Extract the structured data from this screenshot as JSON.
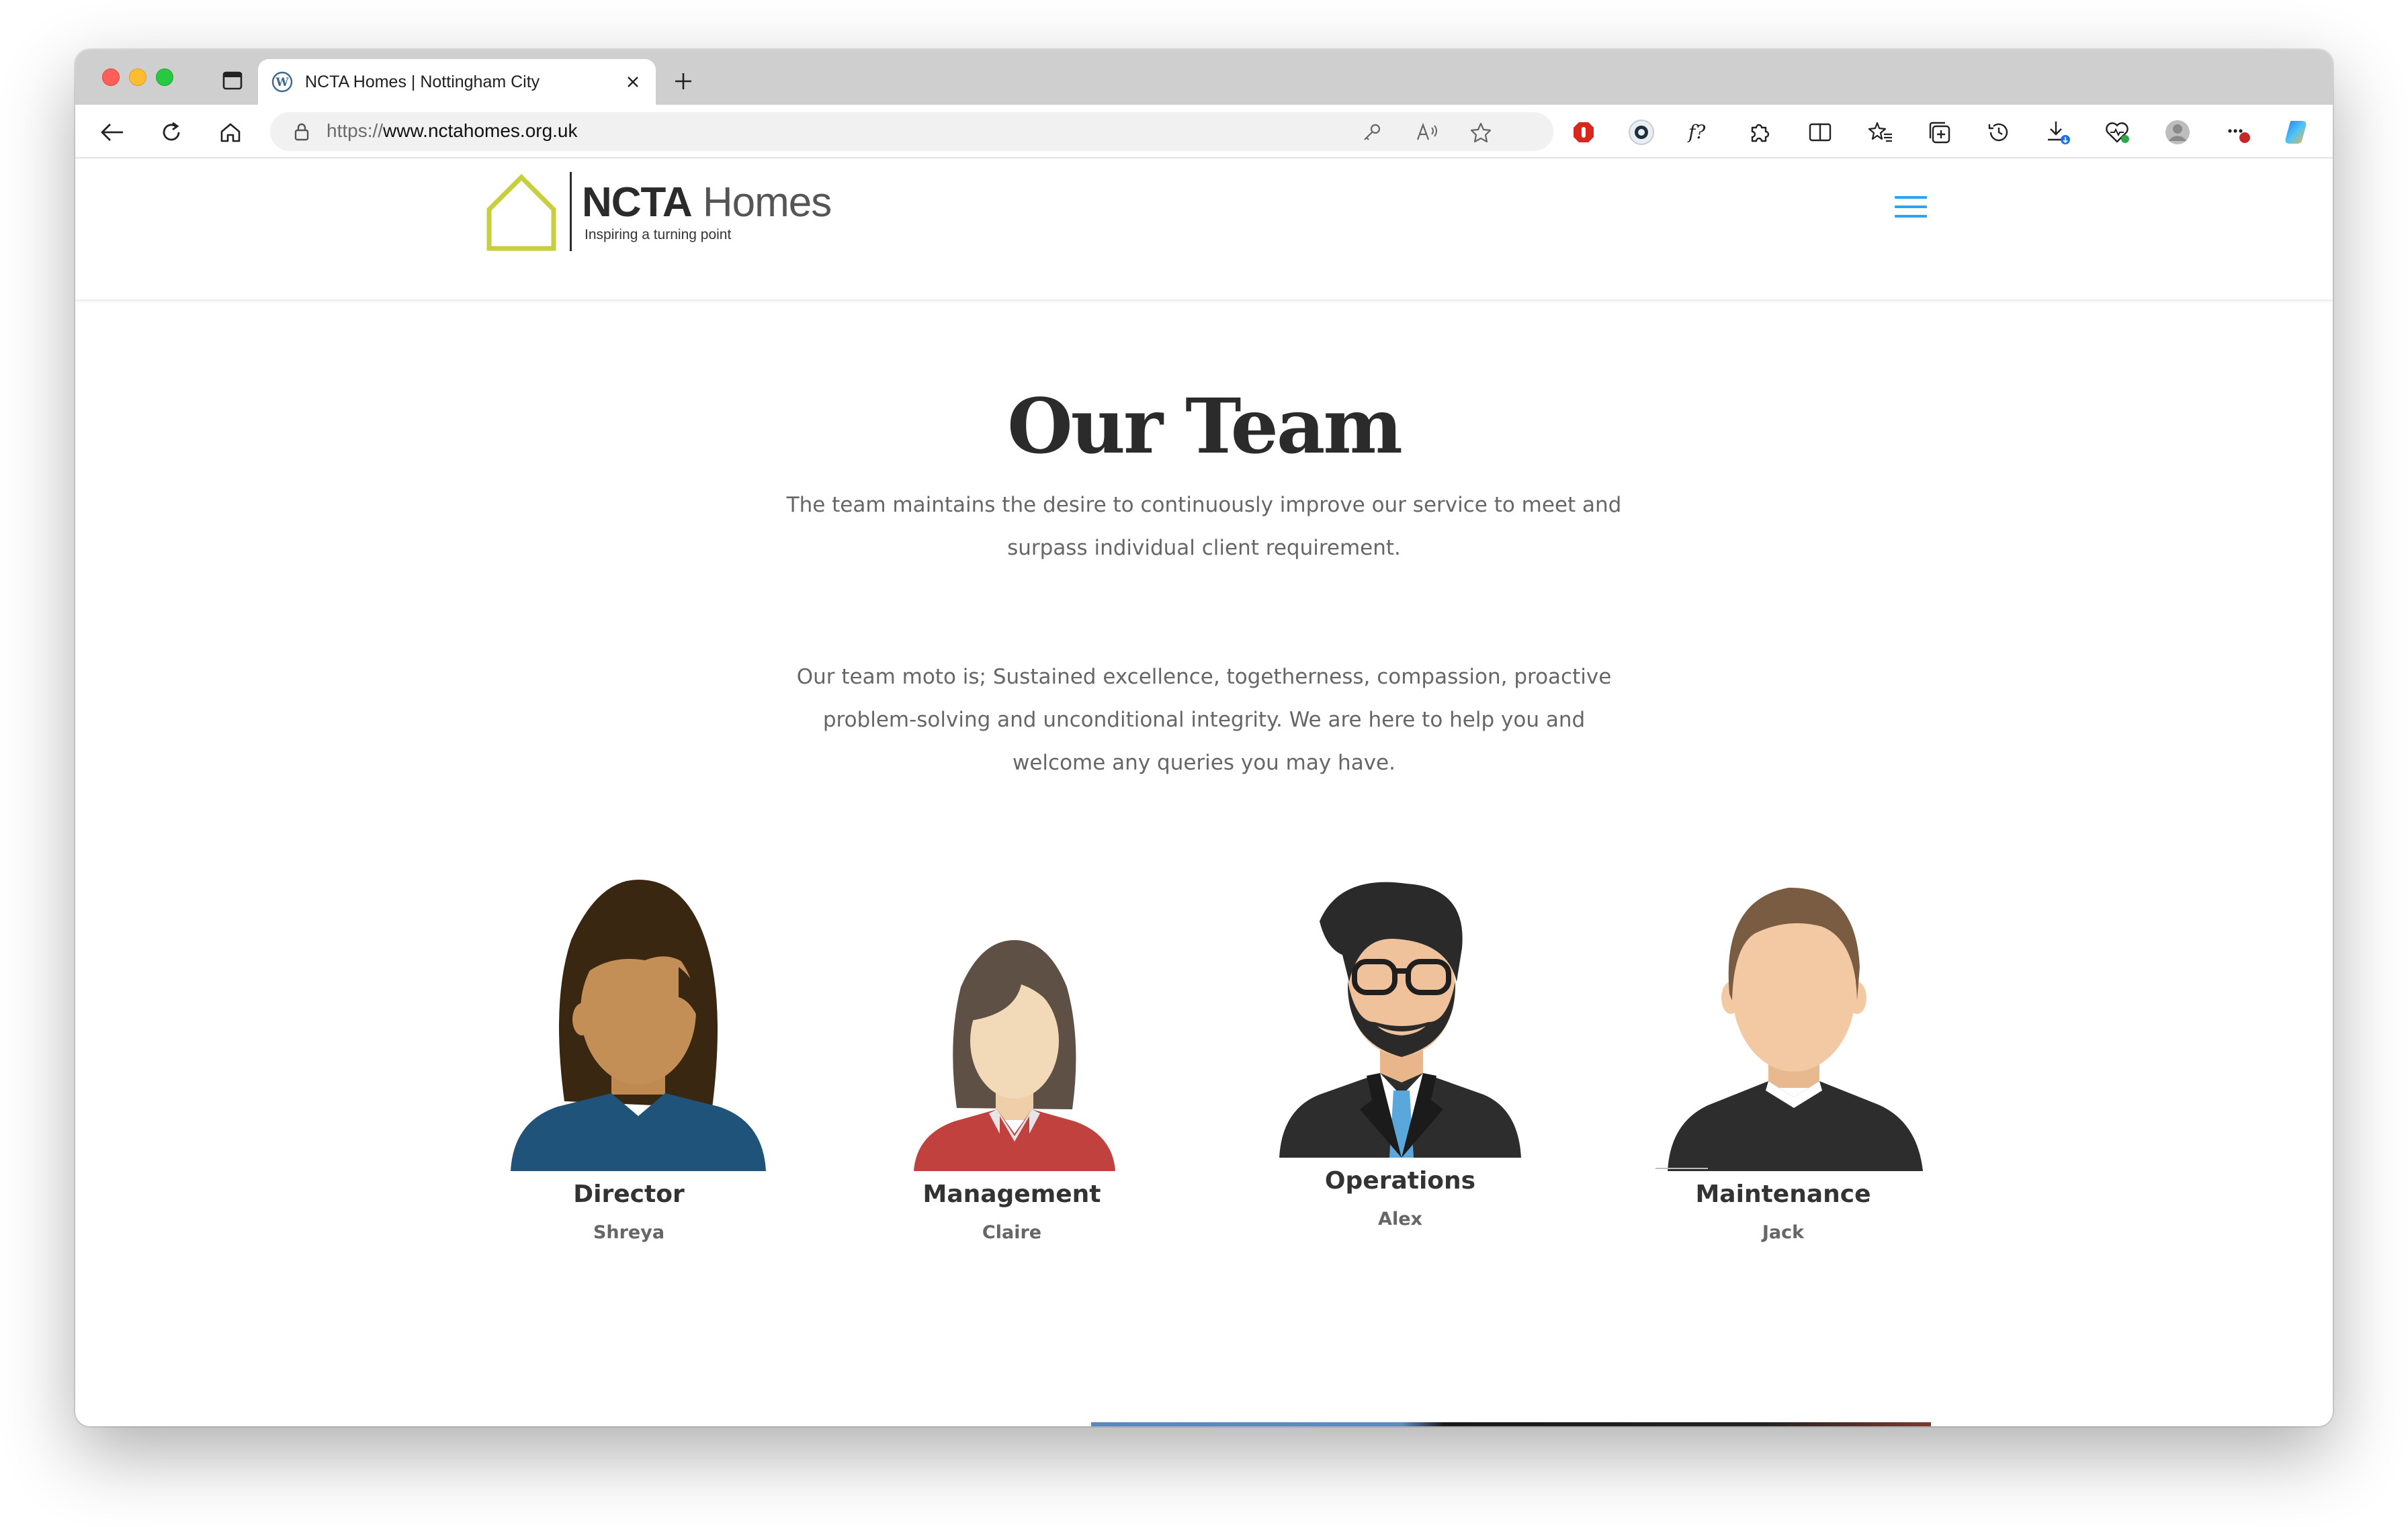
{
  "browser": {
    "tab_title": "NCTA Homes | Nottingham City",
    "url_protocol": "https://",
    "url_host": "www.nctahomes.org.uk",
    "download_badge": "",
    "more_badge": "1"
  },
  "site": {
    "brand_bold": "NCTA",
    "brand_light": " Homes",
    "tagline": "Inspiring a turning point",
    "accent_color": "#2ea3f2",
    "logo_color": "#c7cf3c"
  },
  "page": {
    "title": "Our Team",
    "intro": "The team maintains the desire to continuously improve our service to meet and surpass individual client requirement.",
    "moto": "Our team moto is; Sustained excellence, togetherness, compassion, proactive problem-solving and unconditional integrity. We are here to help you and welcome any queries you may have."
  },
  "team": [
    {
      "role": "Director",
      "name": "Shreya"
    },
    {
      "role": "Management",
      "name": "Claire"
    },
    {
      "role": "Operations",
      "name": "Alex"
    },
    {
      "role": "Maintenance",
      "name": "Jack"
    }
  ]
}
